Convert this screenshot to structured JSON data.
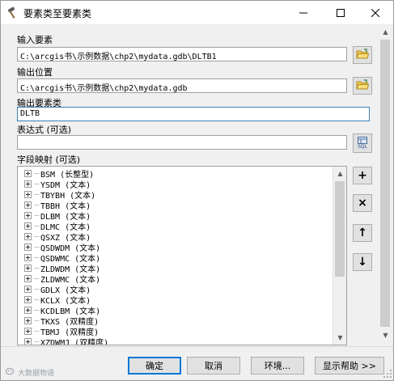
{
  "window": {
    "title": "要素类至要素类"
  },
  "form": {
    "input_features_label": "输入要素",
    "input_features_value": "C:\\arcgis书\\示例数据\\chp2\\mydata.gdb\\DLTB1",
    "output_location_label": "输出位置",
    "output_location_value": "C:\\arcgis书\\示例数据\\chp2\\mydata.gdb",
    "output_fc_label": "输出要素类",
    "output_fc_value": "DLTB",
    "expression_label": "表达式 (可选)",
    "expression_value": "",
    "field_map_label": "字段映射 (可选)",
    "sql_label": "SQL"
  },
  "field_map": [
    "BSM (长整型)",
    "YSDM (文本)",
    "TBYBH (文本)",
    "TBBH (文本)",
    "DLBM (文本)",
    "DLMC (文本)",
    "QSXZ (文本)",
    "QSDWDM (文本)",
    "QSDWMC (文本)",
    "ZLDWDM (文本)",
    "ZLDWMC (文本)",
    "GDLX (文本)",
    "KCLX (文本)",
    "KCDLBM (文本)",
    "TKXS (双精度)",
    "TBMJ (双精度)",
    "XZDWMJ (双精度)"
  ],
  "side_buttons": {
    "add": "+",
    "delete": "×",
    "up": "↑",
    "down": "↓"
  },
  "buttons": {
    "ok": "确定",
    "cancel": "取消",
    "env": "环境...",
    "help": "显示帮助 >>"
  },
  "watermark": "大数据物语"
}
